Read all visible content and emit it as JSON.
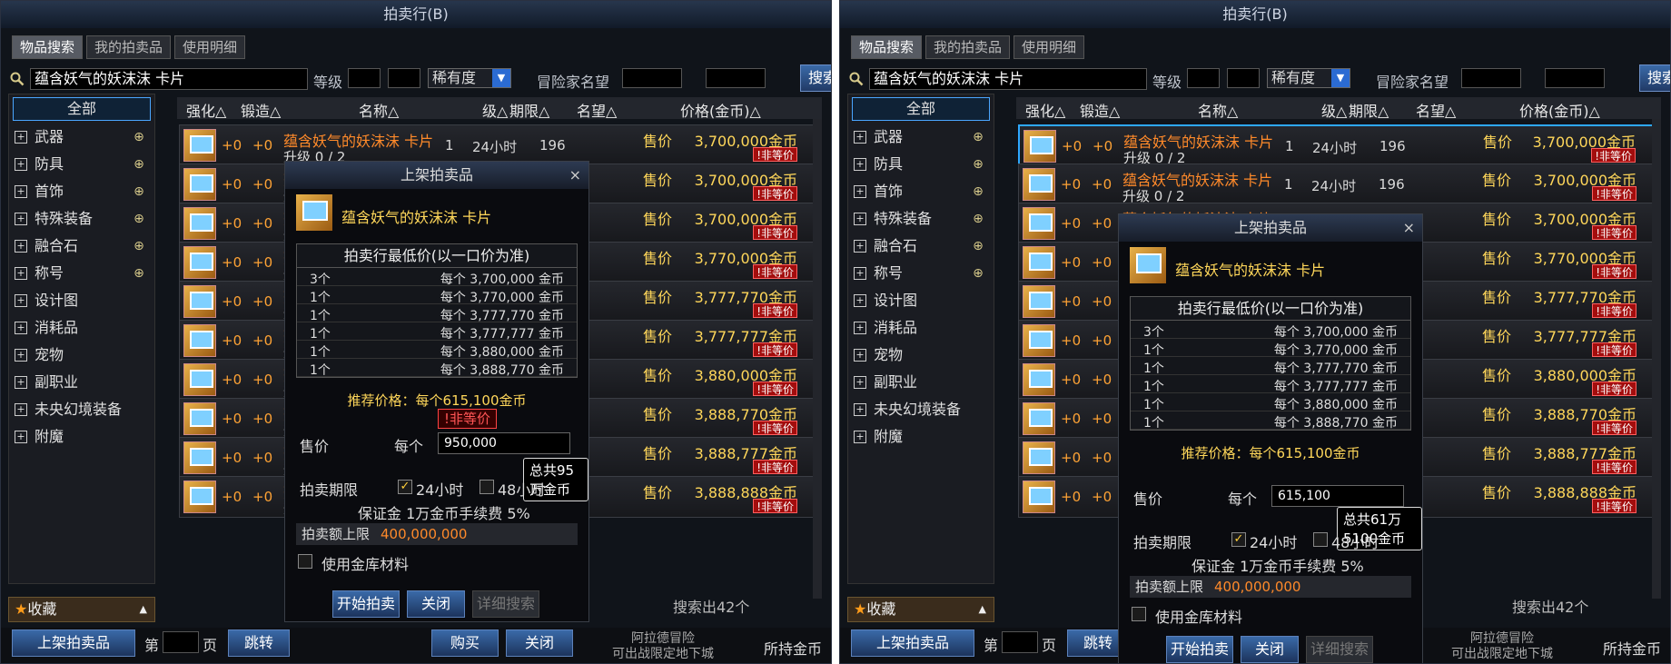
{
  "panels": [
    {
      "title": "拍卖行(B)",
      "tabs": [
        "物品搜索",
        "我的拍卖品",
        "使用明细"
      ],
      "search": {
        "value": "蕴含妖气的妖沫沫 卡片",
        "level_label": "等级",
        "rarity_label": "稀有度",
        "fame_label": "冒险家名望",
        "button": "搜索"
      },
      "categories": [
        "全部",
        "武器",
        "防具",
        "首饰",
        "特殊装备",
        "融合石",
        "称号",
        "设计图",
        "消耗品",
        "宠物",
        "副职业",
        "未央幻境装备",
        "附魔"
      ],
      "favorites": "收藏",
      "columns": [
        "强化△",
        "锻造△",
        "名称△",
        "级△",
        "期限△",
        "名望△",
        "价格(金币)△"
      ],
      "rows": [
        {
          "q": "+0",
          "r": "+0",
          "name": "蕴含妖气的妖沫沫 卡片",
          "sub": "升级 0 / 2",
          "lv": "1",
          "time": "24小时",
          "fame": "196",
          "sell": "售价",
          "price": "3,700,000金币",
          "badge": "!非等价"
        },
        {
          "q": "+0",
          "r": "+0",
          "name": "蕴含妖气的妖沫沫 卡片",
          "sub": "升级 0 / 2",
          "lv": "1",
          "time": "24小时",
          "fame": "196",
          "sell": "售价",
          "price": "3,700,000金币",
          "badge": "!非等价"
        },
        {
          "q": "+0",
          "r": "+0",
          "name": "蕴含妖气的妖沫沫 卡片",
          "sub": "升级 0 / 2",
          "lv": "1",
          "time": "24小时",
          "fame": "196",
          "sell": "售价",
          "price": "3,700,000金币",
          "badge": "!非等价"
        },
        {
          "q": "+0",
          "r": "+0",
          "name": "蕴含妖气的妖沫沫 卡片",
          "sub": "升级 0 / 2",
          "lv": "1",
          "time": "24小时",
          "fame": "196",
          "sell": "售价",
          "price": "3,770,000金币",
          "badge": "!非等价"
        },
        {
          "q": "+0",
          "r": "+0",
          "name": "蕴含妖气的妖沫沫 卡片",
          "sub": "升级 0 / 2",
          "lv": "1",
          "time": "24小时",
          "fame": "196",
          "sell": "售价",
          "price": "3,777,770金币",
          "badge": "!非等价"
        },
        {
          "q": "+0",
          "r": "+0",
          "name": "蕴含妖气的妖沫沫 卡片",
          "sub": "升级 0 / 2",
          "lv": "1",
          "time": "24小时",
          "fame": "196",
          "sell": "售价",
          "price": "3,777,777金币",
          "badge": "!非等价"
        },
        {
          "q": "+0",
          "r": "+0",
          "name": "蕴含妖气的妖沫沫 卡片",
          "sub": "升级 0 / 2",
          "lv": "1",
          "time": "24小时",
          "fame": "196",
          "sell": "售价",
          "price": "3,880,000金币",
          "badge": "!非等价"
        },
        {
          "q": "+0",
          "r": "+0",
          "name": "蕴含妖气的妖沫沫 卡片",
          "sub": "升级 0 / 2",
          "lv": "1",
          "time": "24小时",
          "fame": "196",
          "sell": "售价",
          "price": "3,888,770金币",
          "badge": "!非等价"
        },
        {
          "q": "+0",
          "r": "+0",
          "name": "蕴含妖气的妖沫沫 卡片",
          "sub": "升级 0 / 2",
          "lv": "1",
          "time": "24小时",
          "fame": "196",
          "sell": "售价",
          "price": "3,888,777金币",
          "badge": "!非等价"
        },
        {
          "q": "+0",
          "r": "+0",
          "name": "蕴含妖气的妖沫沫 卡片",
          "sub": "升级 0 / 2",
          "lv": "1",
          "time": "24小时",
          "fame": "196",
          "sell": "售价",
          "price": "3,888,888金币",
          "badge": "!非等价"
        }
      ],
      "result_count": "搜索出42个",
      "bottom": {
        "list_button": "上架拍卖品",
        "page_prefix": "第",
        "page_suffix": "页",
        "jump": "跳转",
        "buy": "购买",
        "close": "关闭",
        "npc_text": "阿拉德冒险\n可出战限定地下城",
        "gold_label": "所持金币"
      },
      "dialog": {
        "title": "上架拍卖品",
        "close": "×",
        "item_name": "蕴含妖气的妖沫沫 卡片",
        "table_title": "拍卖行最低价(以一口价为准)",
        "price_rows": [
          {
            "count": "3个",
            "price": "每个 3,700,000 金币"
          },
          {
            "count": "1个",
            "price": "每个 3,770,000 金币"
          },
          {
            "count": "1个",
            "price": "每个 3,777,770 金币"
          },
          {
            "count": "1个",
            "price": "每个 3,777,777 金币"
          },
          {
            "count": "1个",
            "price": "每个 3,880,000 金币"
          },
          {
            "count": "1个",
            "price": "每个 3,888,770 金币"
          }
        ],
        "recommend": "推荐价格：每个615,100金币",
        "nonequal": "!非等价",
        "sell_label": "售价",
        "each_label": "每个",
        "input_value": "950,000",
        "total": "总共95万金币",
        "period_label": "拍卖期限",
        "opt24": "24小时",
        "opt48": "48小时",
        "deposit": "保证金 1万金币手续费 5%",
        "limit_label": "拍卖额上限",
        "limit_value": "400,000,000",
        "use_storage": "使用金库材料",
        "start": "开始拍卖",
        "close_btn": "关闭",
        "detail": "详细搜索"
      }
    },
    {
      "title": "拍卖行(B)",
      "tabs": [
        "物品搜索",
        "我的拍卖品",
        "使用明细"
      ],
      "search": {
        "value": "蕴含妖气的妖沫沫 卡片",
        "level_label": "等级",
        "rarity_label": "稀有度",
        "fame_label": "冒险家名望",
        "button": "搜索"
      },
      "categories": [
        "全部",
        "武器",
        "防具",
        "首饰",
        "特殊装备",
        "融合石",
        "称号",
        "设计图",
        "消耗品",
        "宠物",
        "副职业",
        "未央幻境装备",
        "附魔"
      ],
      "favorites": "收藏",
      "columns": [
        "强化△",
        "锻造△",
        "名称△",
        "级△",
        "期限△",
        "名望△",
        "价格(金币)△"
      ],
      "rows": [
        {
          "q": "+0",
          "r": "+0",
          "name": "蕴含妖气的妖沫沫 卡片",
          "sub": "升级 0 / 2",
          "lv": "1",
          "time": "24小时",
          "fame": "196",
          "sell": "售价",
          "price": "3,700,000金币",
          "badge": "!非等价"
        },
        {
          "q": "+0",
          "r": "+0",
          "name": "蕴含妖气的妖沫沫 卡片",
          "sub": "升级 0 / 2",
          "lv": "1",
          "time": "24小时",
          "fame": "196",
          "sell": "售价",
          "price": "3,700,000金币",
          "badge": "!非等价"
        },
        {
          "q": "+0",
          "r": "+0",
          "name": "蕴含妖气的妖沫沫 卡片",
          "sub": "升级 0 / 2",
          "lv": "1",
          "time": "24小时",
          "fame": "196",
          "sell": "售价",
          "price": "3,700,000金币",
          "badge": "!非等价"
        },
        {
          "q": "+0",
          "r": "+0",
          "name": "蕴含妖气的妖沫沫 卡片",
          "sub": "升级 0 / 2",
          "lv": "1",
          "time": "24小时",
          "fame": "196",
          "sell": "售价",
          "price": "3,770,000金币",
          "badge": "!非等价"
        },
        {
          "q": "+0",
          "r": "+0",
          "name": "蕴含妖气的妖沫沫 卡片",
          "sub": "升级 0 / 2",
          "lv": "1",
          "time": "24小时",
          "fame": "196",
          "sell": "售价",
          "price": "3,777,770金币",
          "badge": "!非等价"
        },
        {
          "q": "+0",
          "r": "+0",
          "name": "蕴含妖气的妖沫沫 卡片",
          "sub": "升级 0 / 2",
          "lv": "1",
          "time": "24小时",
          "fame": "196",
          "sell": "售价",
          "price": "3,777,777金币",
          "badge": "!非等价"
        },
        {
          "q": "+0",
          "r": "+0",
          "name": "蕴含妖气的妖沫沫 卡片",
          "sub": "升级 0 / 2",
          "lv": "1",
          "time": "24小时",
          "fame": "196",
          "sell": "售价",
          "price": "3,880,000金币",
          "badge": "!非等价"
        },
        {
          "q": "+0",
          "r": "+0",
          "name": "蕴含妖气的妖沫沫 卡片",
          "sub": "升级 0 / 2",
          "lv": "1",
          "time": "24小时",
          "fame": "196",
          "sell": "售价",
          "price": "3,888,770金币",
          "badge": "!非等价"
        },
        {
          "q": "+0",
          "r": "+0",
          "name": "蕴含妖气的妖沫沫 卡片",
          "sub": "升级 0 / 2",
          "lv": "1",
          "time": "24小时",
          "fame": "196",
          "sell": "售价",
          "price": "3,888,777金币",
          "badge": "!非等价"
        },
        {
          "q": "+0",
          "r": "+0",
          "name": "蕴含妖气的妖沫沫 卡片",
          "sub": "升级 0 / 2",
          "lv": "1",
          "time": "24小时",
          "fame": "196",
          "sell": "售价",
          "price": "3,888,888金币",
          "badge": "!非等价"
        }
      ],
      "result_count": "搜索出42个",
      "bottom": {
        "list_button": "上架拍卖品",
        "page_prefix": "第",
        "page_suffix": "页",
        "jump": "跳转",
        "buy": "购买",
        "close": "关闭",
        "npc_text": "阿拉德冒险\n可出战限定地下城",
        "gold_label": "所持金币"
      },
      "dialog": {
        "title": "上架拍卖品",
        "close": "×",
        "item_name": "蕴含妖气的妖沫沫 卡片",
        "table_title": "拍卖行最低价(以一口价为准)",
        "price_rows": [
          {
            "count": "3个",
            "price": "每个 3,700,000 金币"
          },
          {
            "count": "1个",
            "price": "每个 3,770,000 金币"
          },
          {
            "count": "1个",
            "price": "每个 3,777,770 金币"
          },
          {
            "count": "1个",
            "price": "每个 3,777,777 金币"
          },
          {
            "count": "1个",
            "price": "每个 3,880,000 金币"
          },
          {
            "count": "1个",
            "price": "每个 3,888,770 金币"
          }
        ],
        "recommend": "推荐价格：每个615,100金币",
        "sell_label": "售价",
        "each_label": "每个",
        "input_value": "615,100",
        "total": "总共61万5100金币",
        "period_label": "拍卖期限",
        "opt24": "24小时",
        "opt48": "48小时",
        "deposit": "保证金 1万金币手续费 5%",
        "limit_label": "拍卖额上限",
        "limit_value": "400,000,000",
        "use_storage": "使用金库材料",
        "start": "开始拍卖",
        "close_btn": "关闭",
        "detail": "详细搜索"
      }
    }
  ]
}
